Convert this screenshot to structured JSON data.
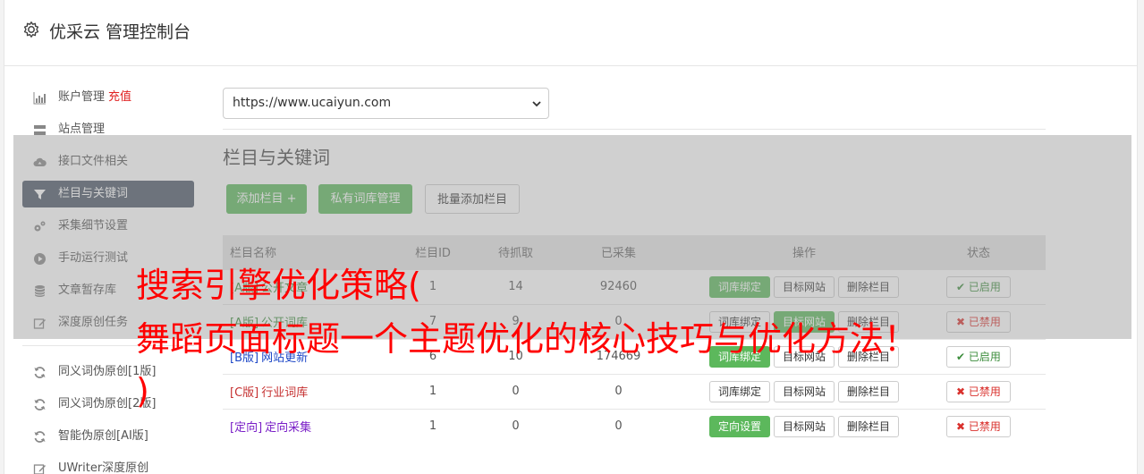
{
  "header": {
    "title": "优采云 管理控制台",
    "icon": "gear-icon"
  },
  "sidebar": {
    "items": [
      {
        "label": "账户管理",
        "badge": "充值",
        "icon": "bar-chart-icon"
      },
      {
        "label": "站点管理",
        "icon": "server-icon"
      },
      {
        "label": "接口文件相关",
        "icon": "cloud-upload-icon"
      },
      {
        "label": "栏目与关键词",
        "icon": "filter-icon",
        "active": true
      },
      {
        "label": "采集细节设置",
        "icon": "cogs-icon"
      },
      {
        "label": "手动运行测试",
        "icon": "play-circle-icon"
      },
      {
        "label": "文章暂存库",
        "icon": "database-icon"
      },
      {
        "label": "深度原创任务",
        "icon": "edit-icon"
      }
    ],
    "items2": [
      {
        "label": "同义词伪原创[1版]",
        "icon": "refresh-icon"
      },
      {
        "label": "同义词伪原创[2版]",
        "icon": "refresh-icon"
      },
      {
        "label": "智能伪原创[AI版]",
        "icon": "refresh-icon"
      },
      {
        "label": "UWriter深度原创",
        "icon": "edit-icon"
      }
    ]
  },
  "site_select": {
    "value": "https://www.ucaiyun.com"
  },
  "section": {
    "title": "栏目与关键词",
    "add_label": "添加栏目 +",
    "private_label": "私有词库管理",
    "batch_label": "批量添加栏目"
  },
  "table": {
    "headers": [
      "栏目名称",
      "栏目ID",
      "待抓取",
      "已采集",
      "操作",
      "状态"
    ],
    "rows": [
      {
        "tag": "[A版]",
        "name": "公开文章",
        "id": "1",
        "pending": "14",
        "collected": "92460",
        "op1": "词库绑定",
        "op2": "目标网站",
        "op3": "删除栏目",
        "status": "已启用"
      },
      {
        "tag": "[A版]",
        "name": "公开词库",
        "id": "7",
        "pending": "9",
        "collected": "0",
        "op1": "词库绑定",
        "op2": "目标网站",
        "op3": "删除栏目",
        "status": "已禁用"
      },
      {
        "tag": "[B版]",
        "name": "网站更新",
        "id": "6",
        "pending": "10",
        "collected": "174669",
        "op1": "词库绑定",
        "op2": "目标网站",
        "op3": "删除栏目",
        "status": "已启用"
      },
      {
        "tag": "[C版]",
        "name": "行业词库",
        "id": "1",
        "pending": "0",
        "collected": "0",
        "op1": "词库绑定",
        "op2": "目标网站",
        "op3": "删除栏目",
        "status": "已禁用"
      },
      {
        "tag": "[定向]",
        "name": "定向采集",
        "id": "1",
        "pending": "0",
        "collected": "0",
        "op1": "定向设置",
        "op2": "目标网站",
        "op3": "删除栏目",
        "status": "已禁用"
      }
    ]
  },
  "overlay_text": {
    "line1": "搜索引擎优化策略(",
    "line2": "舞蹈页面标题一个主题优化的核心技巧与优化方法！",
    "line3": ")"
  },
  "colors": {
    "accent_green": "#5cb85c",
    "sidebar_active": "#4b5667",
    "ad_red": "#ff0000"
  }
}
